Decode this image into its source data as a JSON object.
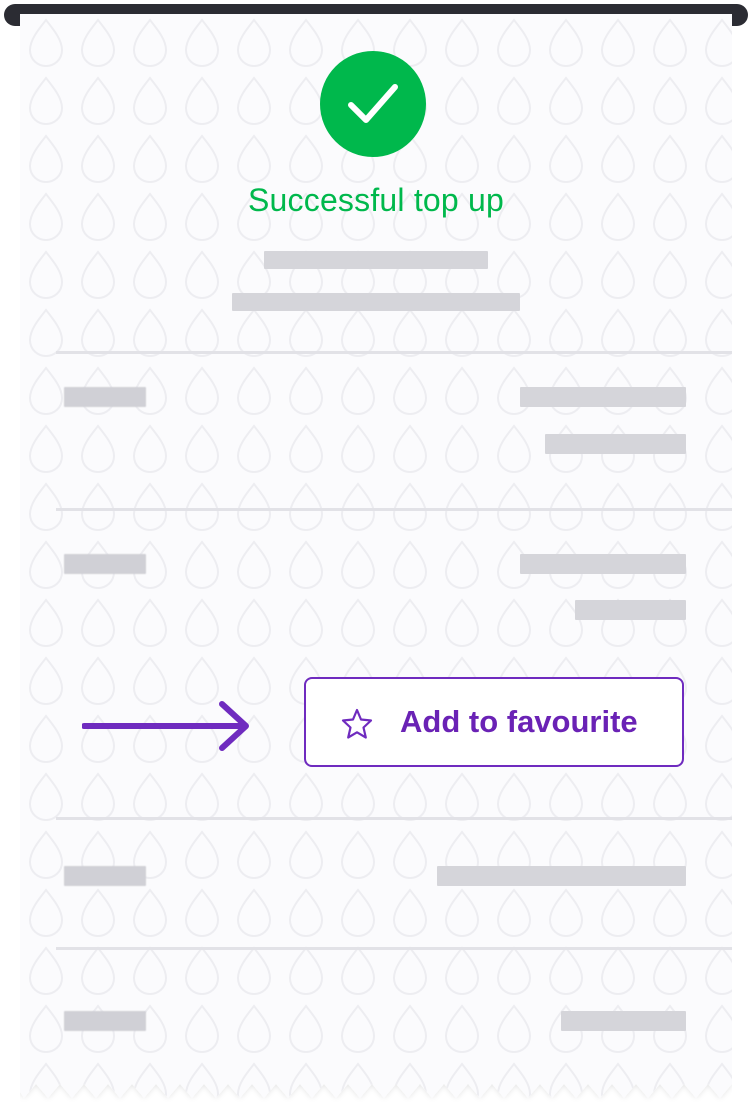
{
  "receipt": {
    "status_title": "Successful top up",
    "status_icon": "check-circle-icon",
    "status_color": "#00b84c",
    "background_pattern": "drop-pattern"
  },
  "favourite": {
    "button_label": "Add to favourite",
    "icon": "star-icon",
    "accent_color": "#6f2bbf"
  },
  "pointer": {
    "icon": "arrow-right-icon"
  }
}
